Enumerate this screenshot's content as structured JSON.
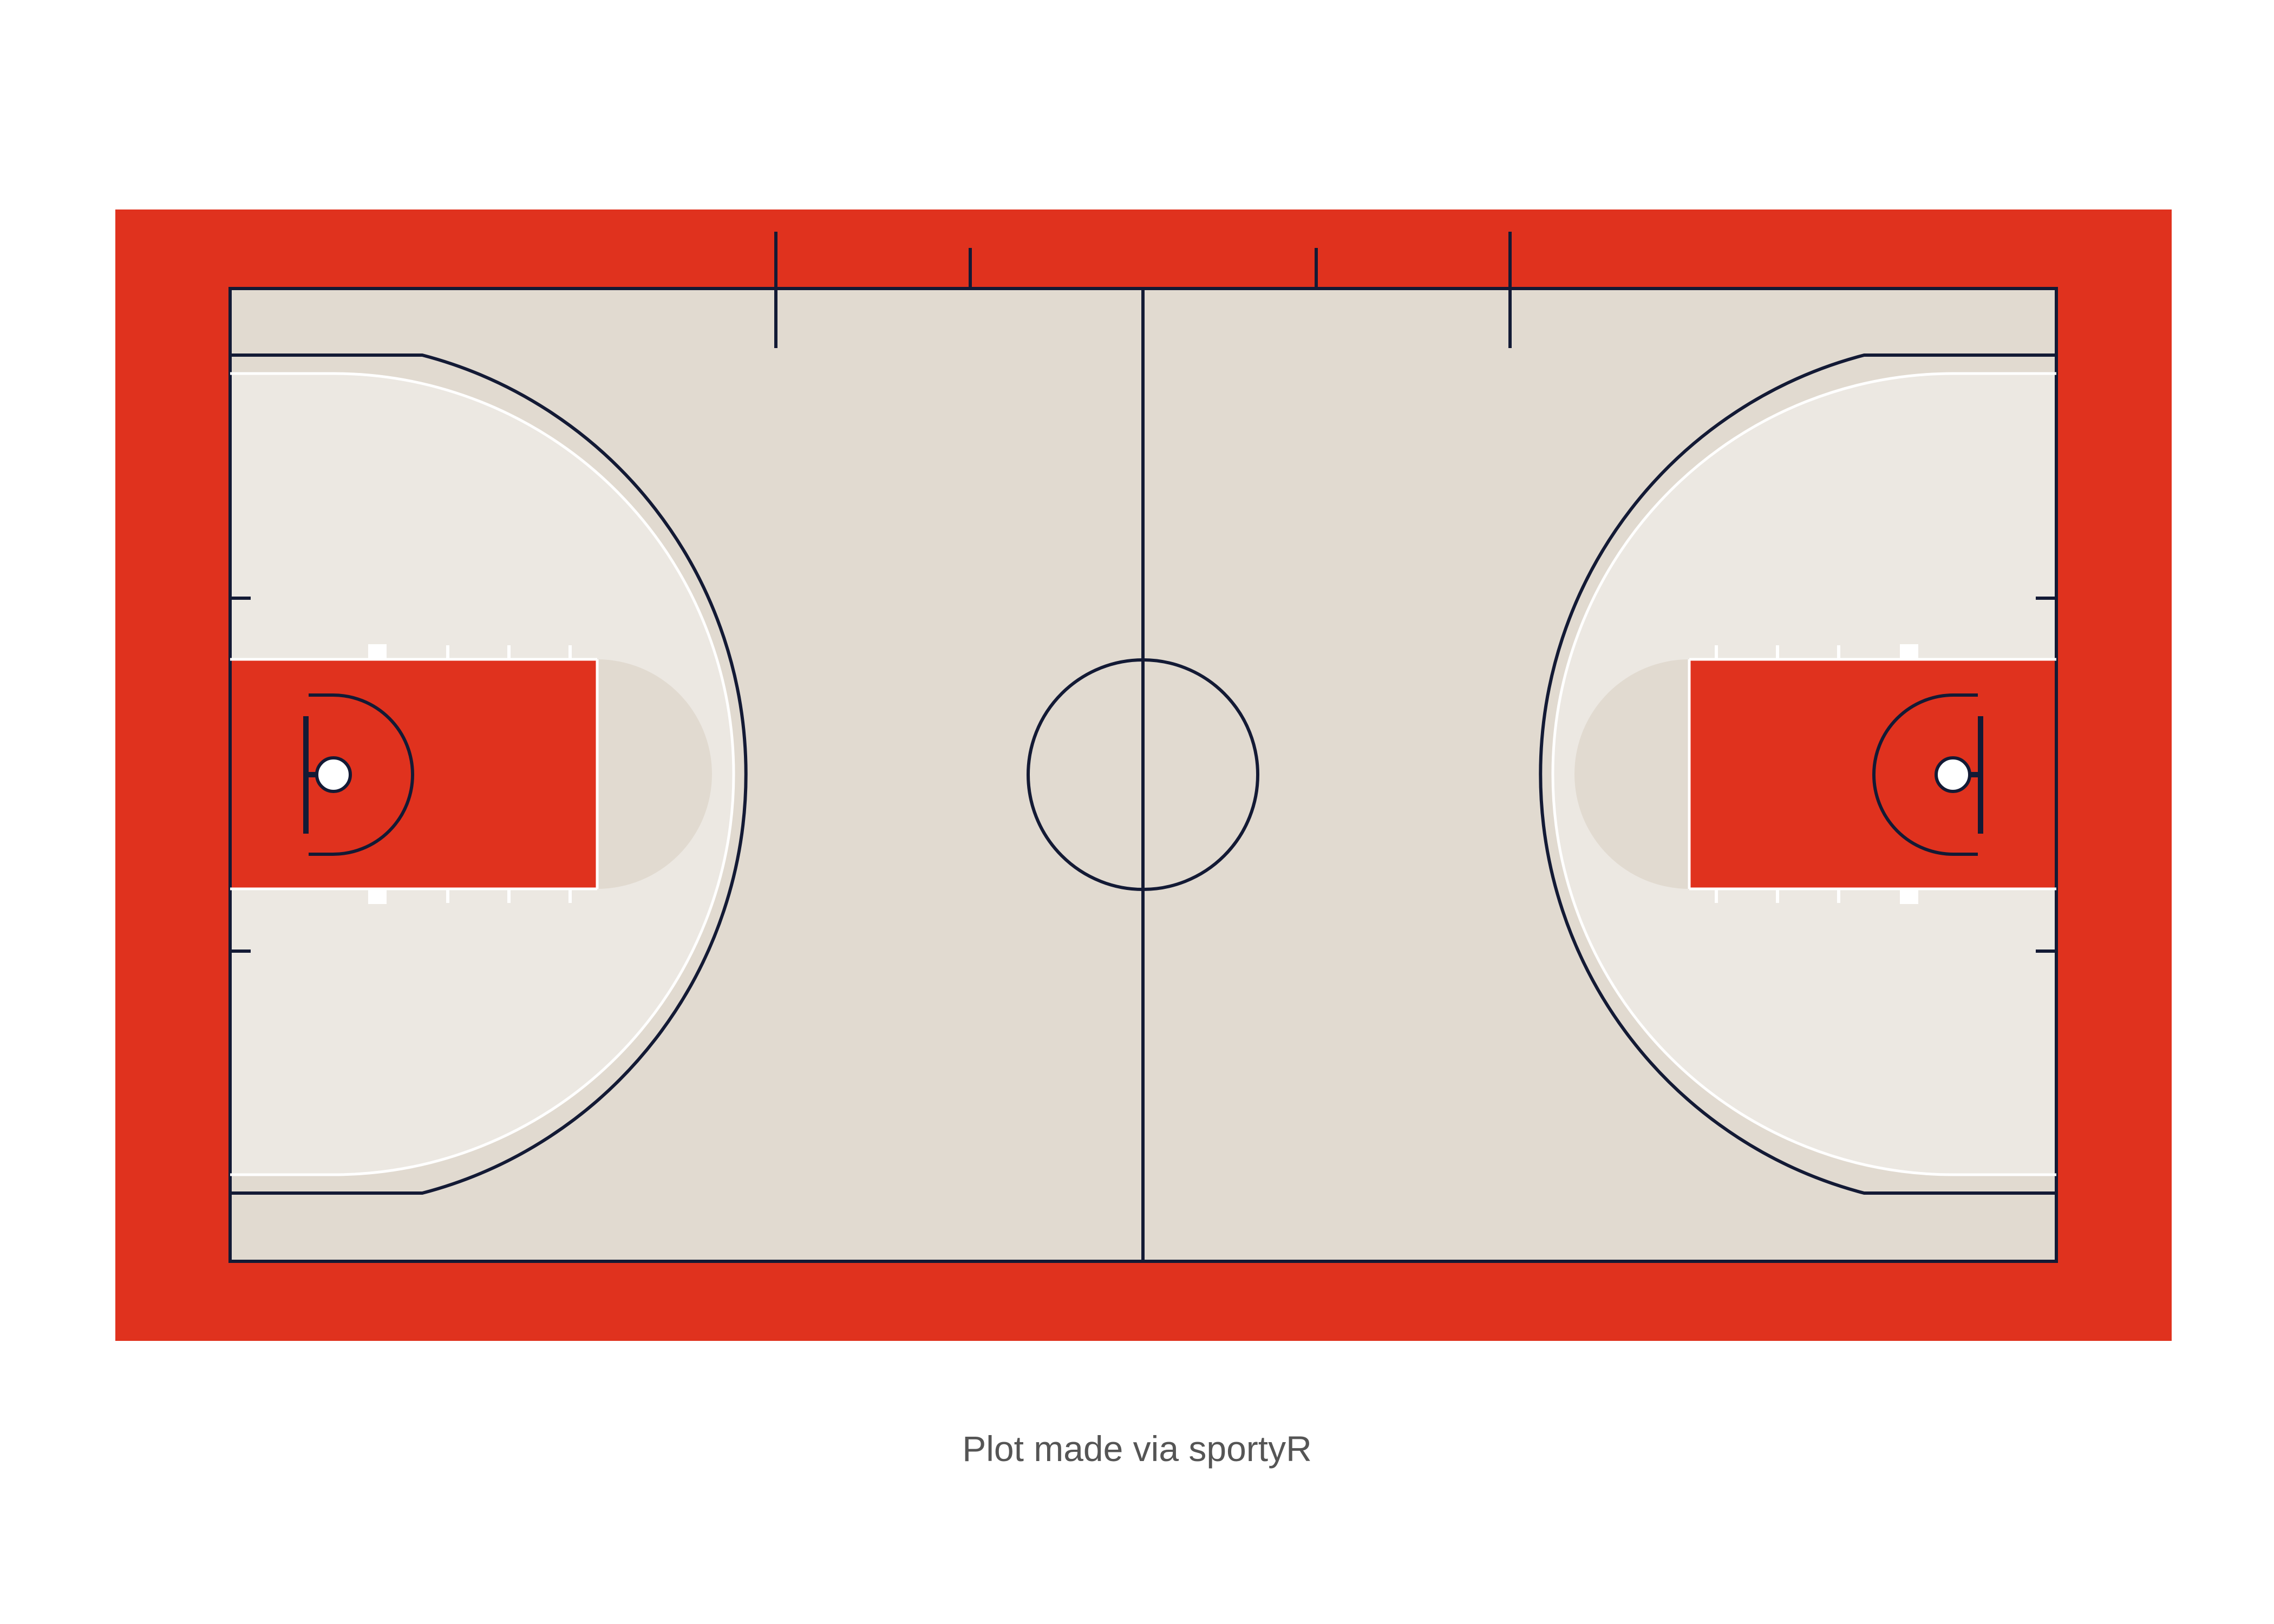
{
  "caption": "Plot made via sportyR",
  "colors": {
    "page_background": "#ffffff",
    "court_apron": "#e0321e",
    "court_background": "#e1dad0",
    "two_point_range": "#ece8e2",
    "painted_area": "#e0321e",
    "court_lines": "#131a35",
    "free_throw_circle_fill": "#e1dad0",
    "painted_area_outline": "#ffffff",
    "lane_space_marks": "#ffffff",
    "basket_ring": "#131a35",
    "net": "#ffffff",
    "backboard": "#131a35",
    "caption_text": "#555555"
  },
  "icons": {
    "basket": "basket-icon"
  }
}
